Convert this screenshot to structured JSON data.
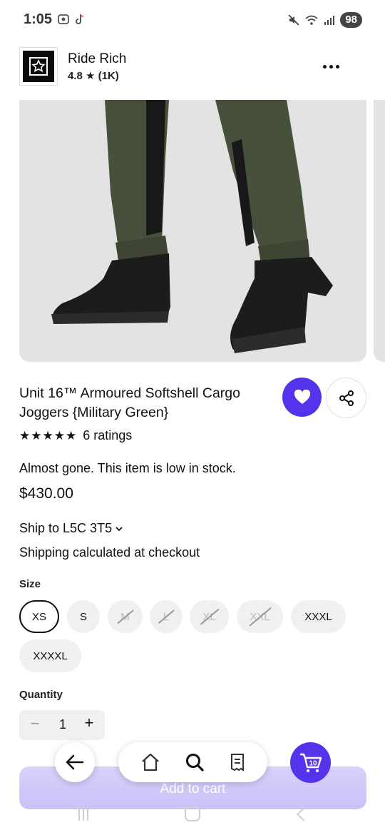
{
  "status_bar": {
    "time": "1:05",
    "battery": "98"
  },
  "shop": {
    "name": "Ride Rich",
    "rating": "4.8 ★ (1K)"
  },
  "product": {
    "title": "Unit 16™ Armoured Softshell Cargo Joggers {Military Green}",
    "stars": "★★★★★",
    "ratings_text": "6 ratings",
    "stock_text": "Almost gone. This item is low in stock.",
    "price": "$430.00",
    "ship_to": "Ship to L5C 3T5",
    "shipping_note": "Shipping calculated at checkout"
  },
  "size": {
    "label": "Size",
    "options": [
      {
        "label": "XS",
        "state": "selected"
      },
      {
        "label": "S",
        "state": "available"
      },
      {
        "label": "M",
        "state": "unavailable"
      },
      {
        "label": "L",
        "state": "unavailable"
      },
      {
        "label": "XL",
        "state": "unavailable"
      },
      {
        "label": "XXL",
        "state": "unavailable"
      },
      {
        "label": "XXXL",
        "state": "available"
      },
      {
        "label": "XXXXL",
        "state": "available"
      }
    ]
  },
  "quantity": {
    "label": "Quantity",
    "value": "1",
    "minus": "−",
    "plus": "+"
  },
  "actions": {
    "add_to_cart": "Add to cart"
  },
  "cart": {
    "count": "10"
  },
  "colors": {
    "accent": "#5433eb",
    "image_bg": "#e3e3e3",
    "chip_bg": "#f0f0f2"
  },
  "icons": [
    "camera-capture-icon",
    "tiktok-icon",
    "mute-icon",
    "wifi-icon",
    "signal-icon",
    "more-icon",
    "heart-icon",
    "share-icon",
    "chevron-down-icon",
    "back-arrow-icon",
    "home-icon",
    "search-icon",
    "receipt-icon",
    "cart-icon"
  ]
}
